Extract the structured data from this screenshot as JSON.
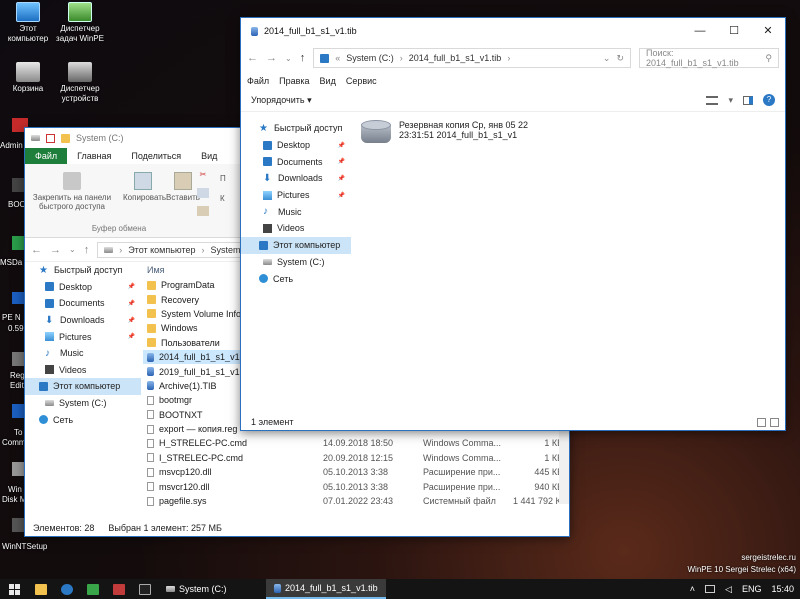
{
  "desktop_icons": [
    {
      "label": "Этот компьютер",
      "icon": "this-pc-icon"
    },
    {
      "label": "Диспетчер задач WinPE",
      "icon": "task-manager-icon"
    },
    {
      "label": "Корзина",
      "icon": "recycle-bin-icon"
    },
    {
      "label": "Диспетчер устройств",
      "icon": "device-manager-icon"
    }
  ],
  "partial_icons": [
    "Admin",
    "BOO",
    "MSDa",
    "PE N",
    "0.59",
    "Reg",
    "Edit",
    "To",
    "Comm",
    "Win",
    "Disk M"
  ],
  "winntsetup_label": "WinNTSetup",
  "branding": {
    "line1": "sergeistrelec.ru",
    "line2": "WinPE 10 Sergei Strelec (x64)"
  },
  "back_window": {
    "title": "System (C:)",
    "tabs": [
      "Файл",
      "Главная",
      "Поделиться",
      "Вид"
    ],
    "ribbon": {
      "pin": "Закрепить на панели быстрого доступа",
      "copy": "Копировать",
      "paste": "Вставить",
      "group": "Буфер обмена",
      "partial1": "П",
      "partial2": "К"
    },
    "address": [
      "Этот компьютер",
      "System (C"
    ],
    "nav": [
      {
        "label": "Быстрый доступ",
        "icon": "star-icon",
        "pin": false,
        "level": 0
      },
      {
        "label": "Desktop",
        "icon": "desktop-icon",
        "pin": true,
        "level": 1
      },
      {
        "label": "Documents",
        "icon": "documents-icon",
        "pin": true,
        "level": 1
      },
      {
        "label": "Downloads",
        "icon": "downloads-icon",
        "pin": true,
        "level": 1
      },
      {
        "label": "Pictures",
        "icon": "pictures-icon",
        "pin": true,
        "level": 1
      },
      {
        "label": "Music",
        "icon": "music-icon",
        "pin": false,
        "level": 1
      },
      {
        "label": "Videos",
        "icon": "videos-icon",
        "pin": false,
        "level": 1
      },
      {
        "label": "Этот компьютер",
        "icon": "this-pc-icon",
        "pin": false,
        "level": 0,
        "selected": true
      },
      {
        "label": "System (C:)",
        "icon": "drive-icon",
        "pin": false,
        "level": 1
      },
      {
        "label": "Сеть",
        "icon": "network-icon",
        "pin": false,
        "level": 0
      }
    ],
    "column_name": "Имя",
    "files": [
      {
        "name": "ProgramData",
        "date": "",
        "type": "",
        "size": "",
        "icon": "folder-icon"
      },
      {
        "name": "Recovery",
        "date": "",
        "type": "",
        "size": "",
        "icon": "folder-icon"
      },
      {
        "name": "System Volume Inform",
        "date": "",
        "type": "",
        "size": "",
        "icon": "folder-icon"
      },
      {
        "name": "Windows",
        "date": "",
        "type": "",
        "size": "",
        "icon": "folder-icon"
      },
      {
        "name": "Пользователи",
        "date": "",
        "type": "",
        "size": "",
        "icon": "folder-icon"
      },
      {
        "name": "2014_full_b1_s1_v1.tib",
        "date": "",
        "type": "",
        "size": "",
        "icon": "tib-file-icon",
        "selected": true
      },
      {
        "name": "2019_full_b1_s1_v1.tib",
        "date": "",
        "type": "",
        "size": "",
        "icon": "tib-file-icon"
      },
      {
        "name": "Archive(1).TIB",
        "date": "",
        "type": "",
        "size": "",
        "icon": "tib-file-icon"
      },
      {
        "name": "bootmgr",
        "date": "",
        "type": "",
        "size": "",
        "icon": "file-icon"
      },
      {
        "name": "BOOTNXT",
        "date": "",
        "type": "",
        "size": "",
        "icon": "file-icon"
      },
      {
        "name": "export — копия.reg",
        "date": "",
        "type": "",
        "size": "",
        "icon": "reg-file-icon"
      },
      {
        "name": "H_STRELEC-PC.cmd",
        "date": "14.09.2018 18:50",
        "type": "Windows Comma...",
        "size": "1 КБ",
        "icon": "cmd-file-icon"
      },
      {
        "name": "I_STRELEC-PC.cmd",
        "date": "20.09.2018 12:15",
        "type": "Windows Comma...",
        "size": "1 КБ",
        "icon": "cmd-file-icon"
      },
      {
        "name": "msvcp120.dll",
        "date": "05.10.2013 3:38",
        "type": "Расширение при...",
        "size": "445 КБ",
        "icon": "dll-file-icon"
      },
      {
        "name": "msvcr120.dll",
        "date": "05.10.2013 3:38",
        "type": "Расширение при...",
        "size": "940 КБ",
        "icon": "dll-file-icon"
      },
      {
        "name": "pagefile.sys",
        "date": "07.01.2022 23:43",
        "type": "Системный файл",
        "size": "1 441 792 КБ",
        "icon": "sys-file-icon"
      }
    ],
    "status": {
      "count": "Элементов: 28",
      "selected": "Выбран 1 элемент: 257 МБ"
    }
  },
  "front_window": {
    "title": "2014_full_b1_s1_v1.tib",
    "address": [
      "System (C:)",
      "2014_full_b1_s1_v1.tib"
    ],
    "search_placeholder": "Поиск: 2014_full_b1_s1_v1.tib",
    "menu": [
      "Файл",
      "Правка",
      "Вид",
      "Сервис"
    ],
    "organize": "Упорядочить",
    "nav": [
      {
        "label": "Быстрый доступ",
        "icon": "star-icon",
        "pin": false,
        "level": 0
      },
      {
        "label": "Desktop",
        "icon": "desktop-icon",
        "pin": true,
        "level": 1
      },
      {
        "label": "Documents",
        "icon": "documents-icon",
        "pin": true,
        "level": 1
      },
      {
        "label": "Downloads",
        "icon": "downloads-icon",
        "pin": true,
        "level": 1
      },
      {
        "label": "Pictures",
        "icon": "pictures-icon",
        "pin": true,
        "level": 1
      },
      {
        "label": "Music",
        "icon": "music-icon",
        "pin": false,
        "level": 1
      },
      {
        "label": "Videos",
        "icon": "videos-icon",
        "pin": false,
        "level": 1
      },
      {
        "label": "Этот компьютер",
        "icon": "this-pc-icon",
        "pin": false,
        "level": 0,
        "selected": true
      },
      {
        "label": "System (C:)",
        "icon": "drive-icon",
        "pin": false,
        "level": 1
      },
      {
        "label": "Сеть",
        "icon": "network-icon",
        "pin": false,
        "level": 0
      }
    ],
    "item": {
      "line1": "Резервная копия Ср, янв 05 22",
      "line2": "23:31:51 2014_full_b1_s1_v1"
    },
    "status": "1 элемент"
  },
  "taskbar": {
    "tasks": [
      {
        "label": "System (C:)",
        "active": false
      },
      {
        "label": "2014_full_b1_s1_v1.tib",
        "active": true
      }
    ],
    "lang": "ENG",
    "time": "15:40"
  }
}
